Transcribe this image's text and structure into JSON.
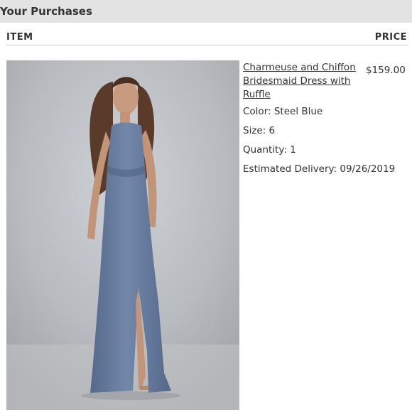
{
  "header": {
    "title": "Your Purchases"
  },
  "table": {
    "col_item": "ITEM",
    "col_price": "PRICE"
  },
  "item": {
    "name": "Charmeuse and Chiffon Bridesmaid Dress with Ruffle",
    "price": "$159.00",
    "color": "Color: Steel Blue",
    "size": "Size: 6",
    "quantity": "Quantity: 1",
    "delivery": "Estimated Delivery: 09/26/2019",
    "image_icon": "product-photo-dress"
  },
  "colors": {
    "header_bg": "#e3e3e3",
    "dress": "#6b80a3",
    "backdrop": "#b9bcc0"
  }
}
